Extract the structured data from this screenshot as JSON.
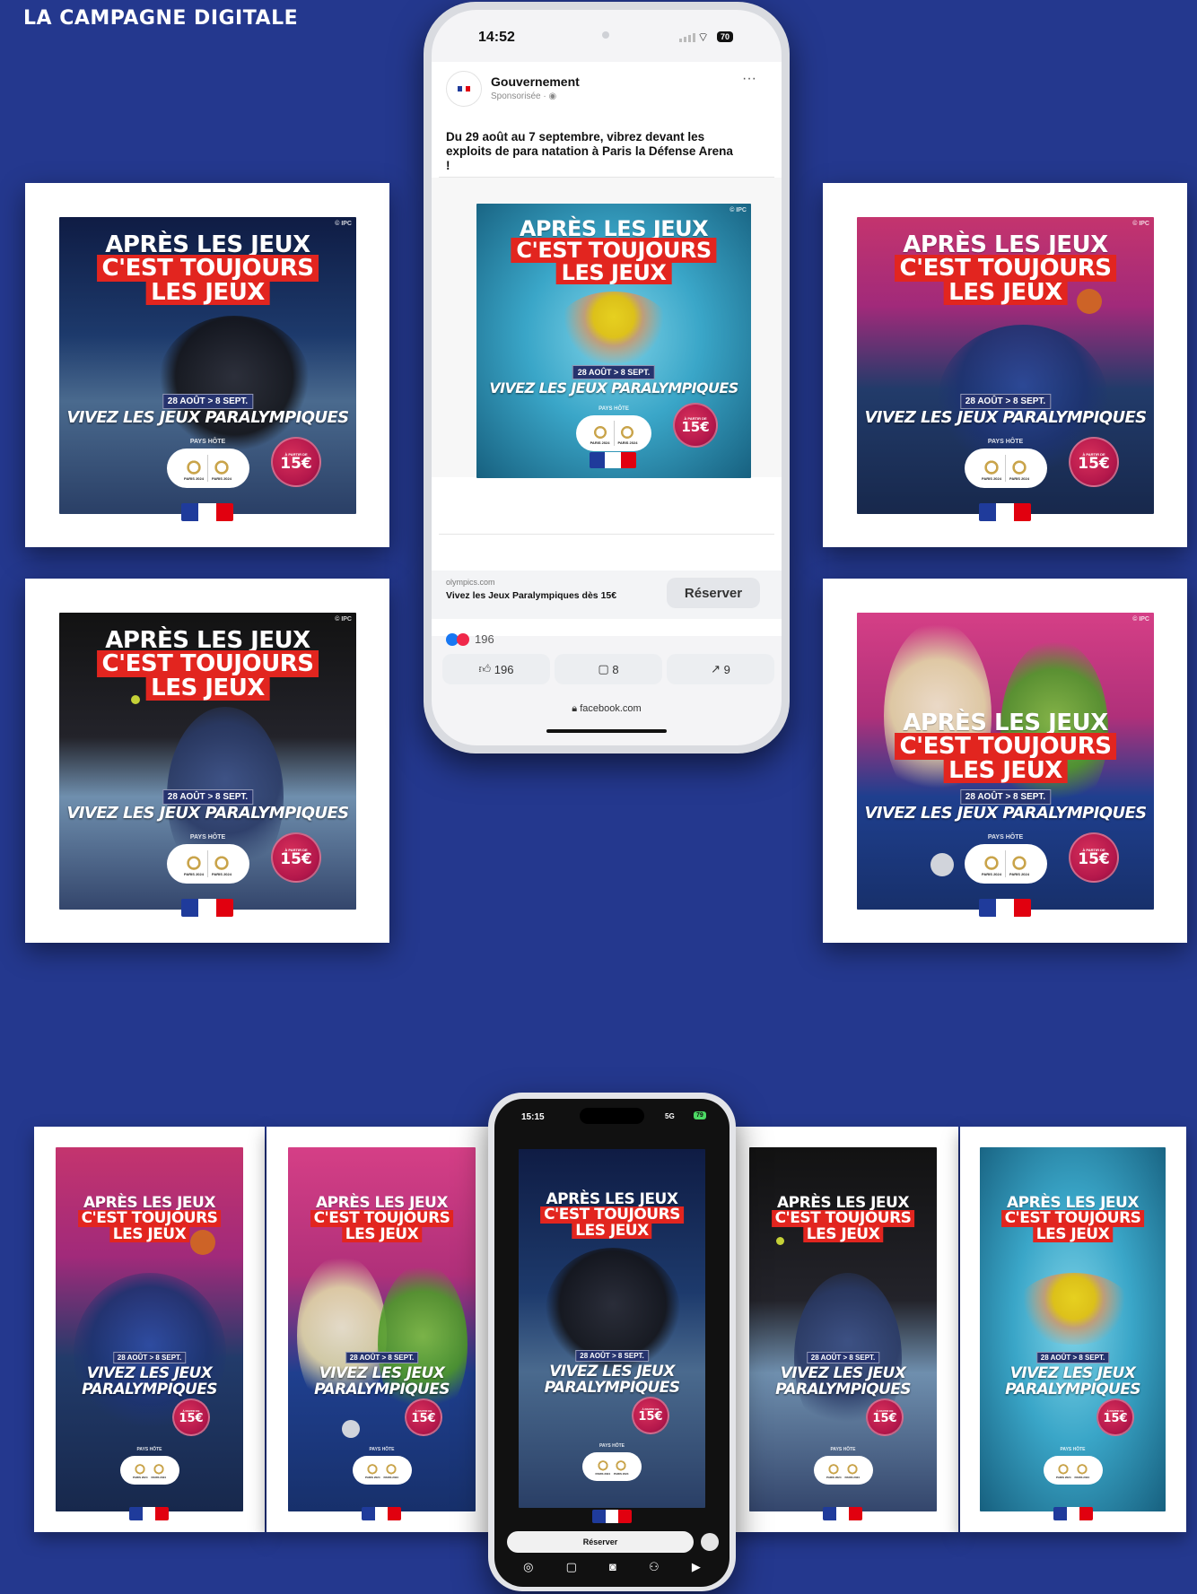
{
  "heading": "LA CAMPAGNE DIGITALE",
  "poster": {
    "line1": "APRÈS LES JEUX",
    "line2": "C'EST TOUJOURS",
    "line3": "LES JEUX",
    "dates": "28 AOÛT > 8 SEPT.",
    "vivez_one_line": "VIVEZ LES JEUX PARALYMPIQUES",
    "vivez_a": "VIVEZ LES JEUX",
    "vivez_b": "PARALYMPIQUES",
    "pays_hote": "PAYS HÔTE",
    "price_prefix": "À PARTIR DE",
    "price": "15€",
    "logo_text": "PARIS 2024",
    "ipc": "© IPC"
  },
  "facebook_phone": {
    "time": "14:52",
    "battery": "70",
    "page_name": "Gouvernement",
    "sponsored": "Sponsorisée · ",
    "more": "···",
    "post_text": "Du 29 août au 7 septembre, vibrez devant les exploits de para natation à Paris la Défense Arena !",
    "link_domain": "olympics.com",
    "link_title": "Vivez les Jeux Paralympiques dès 15€",
    "cta": "Réserver",
    "reactions_count": "196",
    "like_count": "196",
    "comment_count": "8",
    "share_count": "9",
    "url": "facebook.com"
  },
  "story_phone": {
    "time": "15:15",
    "network": "5G",
    "battery": "79",
    "cta": "Réserver"
  }
}
